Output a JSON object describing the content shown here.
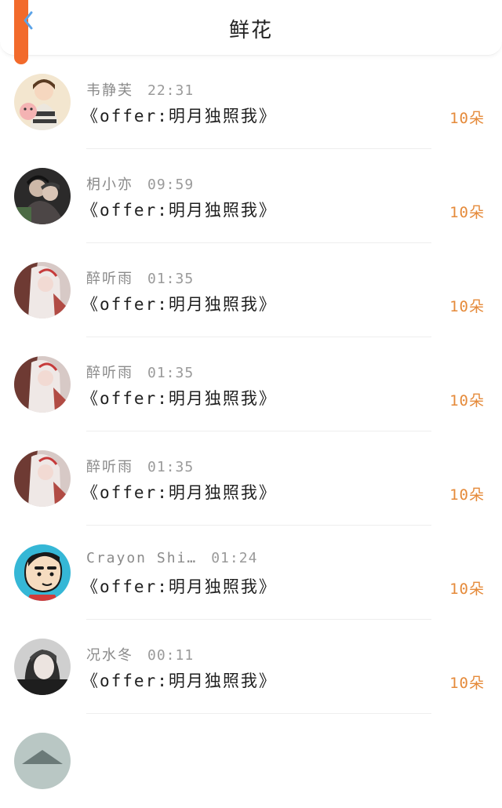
{
  "header": {
    "title": "鲜花"
  },
  "theme": {
    "accent": "#f26a2b",
    "count_color": "#e58a3a"
  },
  "items": [
    {
      "name": "韦静芙",
      "time": "22:31",
      "book": "《offer:明月独照我》",
      "count": "10朵",
      "avatar": "avatar-girl-cat"
    },
    {
      "name": "枂小亦",
      "time": "09:59",
      "book": "《offer:明月独照我》",
      "count": "10朵",
      "avatar": "avatar-dark-couple"
    },
    {
      "name": "醉听雨",
      "time": "01:35",
      "book": "《offer:明月独照我》",
      "count": "10朵",
      "avatar": "avatar-white-hair"
    },
    {
      "name": "醉听雨",
      "time": "01:35",
      "book": "《offer:明月独照我》",
      "count": "10朵",
      "avatar": "avatar-white-hair"
    },
    {
      "name": "醉听雨",
      "time": "01:35",
      "book": "《offer:明月独照我》",
      "count": "10朵",
      "avatar": "avatar-white-hair"
    },
    {
      "name": "Crayon Shi…",
      "time": "01:24",
      "book": "《offer:明月独照我》",
      "count": "10朵",
      "avatar": "avatar-crayon-shin"
    },
    {
      "name": "况水冬",
      "time": "00:11",
      "book": "《offer:明月独照我》",
      "count": "10朵",
      "avatar": "avatar-girl-photo"
    }
  ]
}
